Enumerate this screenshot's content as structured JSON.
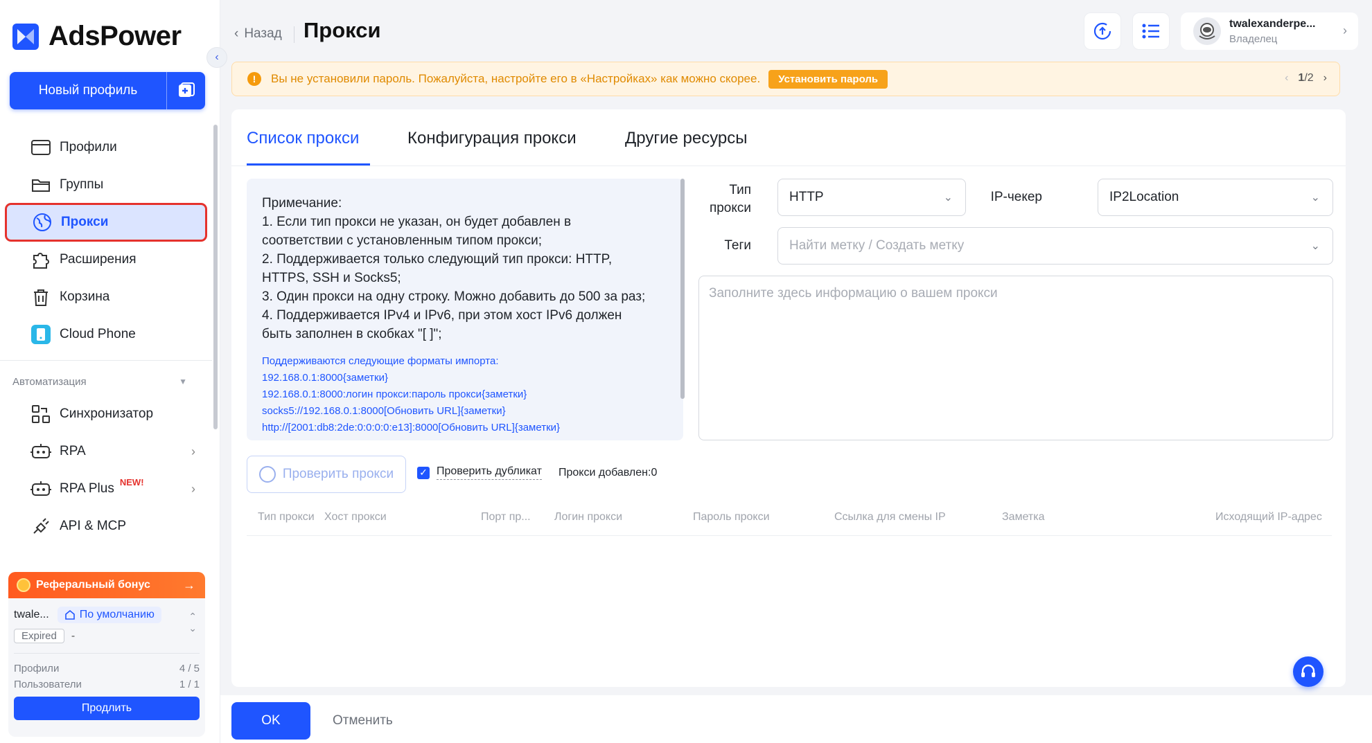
{
  "app": {
    "name": "AdsPower"
  },
  "sidebar": {
    "new_profile_label": "Новый профиль",
    "items": [
      {
        "label": "Профили",
        "icon": "browser-window-icon"
      },
      {
        "label": "Группы",
        "icon": "folder-icon"
      },
      {
        "label": "Прокси",
        "icon": "proxy-globe-icon",
        "active": true
      },
      {
        "label": "Расширения",
        "icon": "puzzle-icon"
      },
      {
        "label": "Корзина",
        "icon": "trash-icon"
      },
      {
        "label": "Cloud Phone",
        "icon": "cloud-phone-icon"
      }
    ],
    "automation_title": "Автоматизация",
    "automation_items": [
      {
        "label": "Синхронизатор",
        "icon": "synchronizer-icon"
      },
      {
        "label": "RPA",
        "icon": "robot-icon"
      },
      {
        "label": "RPA Plus",
        "icon": "robot-icon",
        "badge": "NEW!"
      },
      {
        "label": "API & MCP",
        "icon": "plug-icon"
      }
    ],
    "plan": {
      "referral_label": "Реферальный бонус",
      "referral_arrow": "→",
      "user": "twale...",
      "default_label": "По умолчанию",
      "expired_label": "Expired",
      "expired_value": "-",
      "profiles_label": "Профили",
      "profiles_value": "4 / 5",
      "users_label": "Пользователи",
      "users_value": "1 / 1",
      "renew_label": "Продлить"
    }
  },
  "header": {
    "back_label": "Назад",
    "title": "Прокси",
    "user_name": "twalexanderpe...",
    "user_role": "Владелец"
  },
  "alert": {
    "text": "Вы не установили пароль. Пожалуйста, настройте его в «Настройках» как можно скорее.",
    "button": "Установить пароль",
    "page_current": "1",
    "page_total": "/2"
  },
  "tabs": [
    {
      "label": "Список прокси",
      "active": true
    },
    {
      "label": "Конфигурация прокси"
    },
    {
      "label": "Другие ресурсы"
    }
  ],
  "note": {
    "lines": [
      "Примечание:",
      "1. Если тип прокси не указан, он будет добавлен в",
      "соответствии с установленным типом прокси;",
      "2. Поддерживается только следующий тип прокси: HTTP,",
      "HTTPS, SSH и Socks5;",
      "3. Один прокси на одну строку. Можно добавить до 500 за раз;",
      "4. Поддерживается IPv4 и IPv6, при этом хост IPv6 должен",
      "быть заполнен в скобках \"[ ]\";"
    ],
    "formats_title": "Поддерживаются следующие форматы импорта:",
    "formats": [
      "192.168.0.1:8000{заметки}",
      "192.168.0.1:8000:логин прокси:пароль прокси{заметки}",
      "socks5://192.168.0.1:8000[Обновить URL]{заметки}",
      "http://[2001:db8:2de:0:0:0:0:e13]:8000[Обновить URL]{заметки}"
    ]
  },
  "form": {
    "type_label_1": "Тип",
    "type_label_2": "прокси",
    "type_value": "HTTP",
    "checker_label": "IP-чекер",
    "checker_value": "IP2Location",
    "tags_label": "Теги",
    "tags_placeholder": "Найти метку / Создать метку",
    "textarea_placeholder": "Заполните здесь информацию о вашем прокси"
  },
  "actions": {
    "check_label": "Проверить прокси",
    "dup_label": "Проверить дубликат",
    "dup_checked": true,
    "added_label": "Прокси добавлен:0"
  },
  "table": {
    "columns": [
      "Тип прокси",
      "Хост прокси",
      "Порт пр...",
      "Логин прокси",
      "Пароль прокси",
      "Ссылка для смены IP",
      "Заметка",
      "Исходящий IP-адрес"
    ]
  },
  "footer": {
    "ok_label": "OK",
    "cancel_label": "Отменить"
  },
  "colors": {
    "accent": "#1f55ff",
    "warning": "#f7a21a",
    "highlight": "#e5322d"
  }
}
